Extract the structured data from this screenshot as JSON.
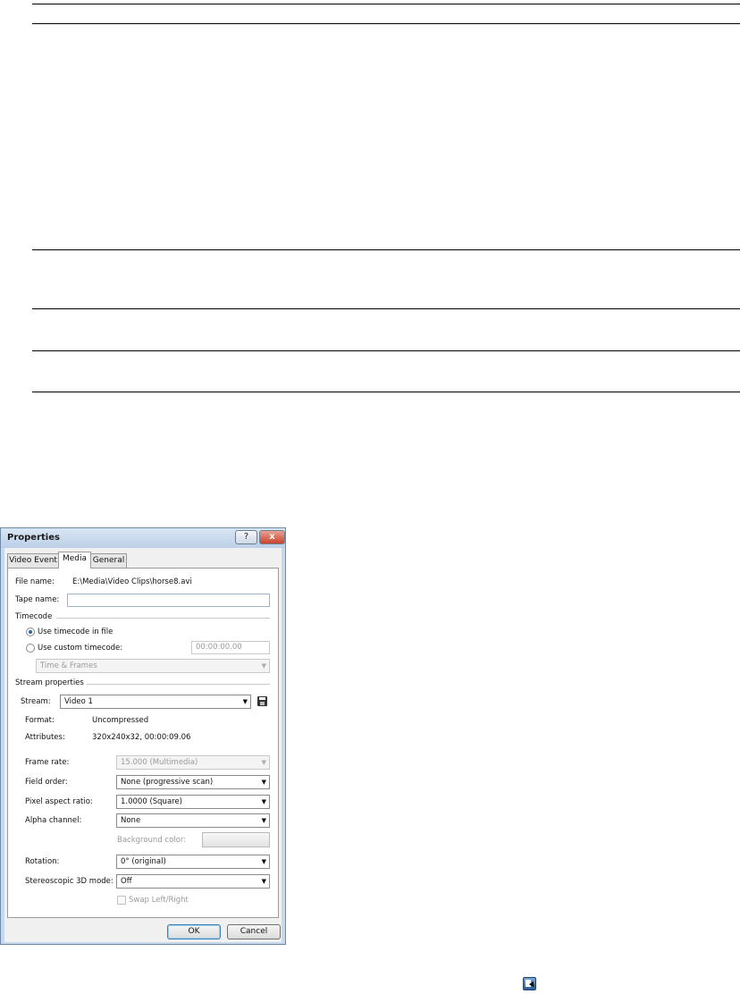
{
  "dialog": {
    "title": "Properties",
    "help_glyph": "?",
    "close_glyph": "x"
  },
  "tabs": [
    {
      "label": "Video Event",
      "active": false
    },
    {
      "label": "Media",
      "active": true
    },
    {
      "label": "General",
      "active": false
    }
  ],
  "media": {
    "file_name_label": "File name:",
    "file_name_value": "E:\\Media\\Video Clips\\horse8.avi",
    "tape_name_label": "Tape name:",
    "tape_name_value": "",
    "timecode_group": "Timecode",
    "use_file_timecode": "Use timecode in file",
    "use_custom_timecode": "Use custom timecode:",
    "custom_timecode_value": "00:00:00.00",
    "time_format": "Time & Frames",
    "stream_group": "Stream properties",
    "stream_label": "Stream:",
    "stream_value": "Video 1",
    "format_label": "Format:",
    "format_value": "Uncompressed",
    "attributes_label": "Attributes:",
    "attributes_value": "320x240x32, 00:00:09.06",
    "frame_rate_label": "Frame rate:",
    "frame_rate_value": "15.000 (Multimedia)",
    "field_order_label": "Field order:",
    "field_order_value": "None (progressive scan)",
    "pixel_aspect_label": "Pixel aspect ratio:",
    "pixel_aspect_value": "1.0000 (Square)",
    "alpha_label": "Alpha channel:",
    "alpha_value": "None",
    "background_color_label": "Background color:",
    "rotation_label": "Rotation:",
    "rotation_value": "0° (original)",
    "stereo_label": "Stereoscopic 3D mode:",
    "stereo_value": "Off",
    "swap_label": "Swap Left/Right"
  },
  "buttons": {
    "ok": "OK",
    "cancel": "Cancel"
  },
  "icons": {
    "dropdown": "▼",
    "save": "save-icon",
    "select_event": "select-event-icon"
  }
}
